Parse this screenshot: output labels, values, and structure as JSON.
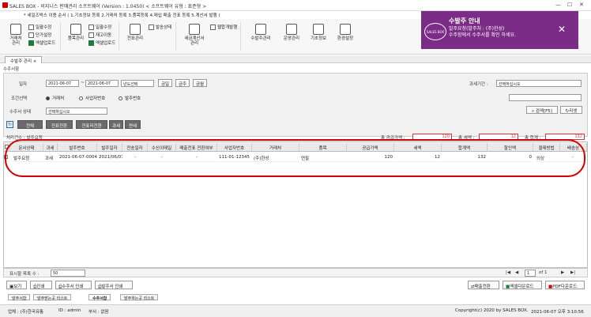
{
  "window": {
    "title": "SALES BOX - 비지니스 판매관리 소프트웨어 (Version : 1.0450) < 소프트웨어 유형 : 표준형 >",
    "marquee": "* 세일즈박스 이용 순서 ( 1.기초정보 등록 2.거래처 등록 3.품목등록 4.매입 매출 전표 등록 5.계산서 발행 )"
  },
  "ribbon": {
    "big": [
      {
        "label": "거래처\n관리"
      },
      {
        "label": "품목관리"
      },
      {
        "label": "전표관리"
      },
      {
        "label": "세금계산서\n관리"
      },
      {
        "label": "수발주관리"
      },
      {
        "label": "운영관리"
      },
      {
        "label": "기초정보"
      },
      {
        "label": "환경설정"
      }
    ],
    "small": {
      "cust_upload": "일괄수정",
      "cust_price": "단가설정",
      "cust_excel": "엑셀업로드",
      "item_upload": "일괄수정",
      "item_stock": "재고이동",
      "item_excel": "엑셀업로드",
      "slip_send": "발송상태",
      "tax_dev": "웹합개발행"
    }
  },
  "notice": {
    "logo": "SALES BOX",
    "title": "수발주 안내",
    "line1": "발주요청(발주처 : (주)한성)",
    "line2": "수주함에서 수주서를 확인 하세요.",
    "close": "✕"
  },
  "tabs": {
    "active": "수발주 관리",
    "close": "×"
  },
  "section_title": "수주서함",
  "filters": {
    "date_label": "일자",
    "date_from": "2021-06-07",
    "tilde": "~",
    "date_to": "2021-06-07",
    "year_select": "년도선택",
    "today": "금일",
    "this_week": "금주",
    "this_month": "금월",
    "tax_period_label": "과세기간 :",
    "tax_period_value": "선택하십시오",
    "cond_label": "조건선택",
    "radio_customer": "거래처",
    "radio_bizno": "사업자번호",
    "radio_orderno": "발주번호",
    "status_label": "수주서 상태",
    "status_value": "선택하십시오",
    "search_btn": "검색[F5]",
    "reset_btn": "리셋"
  },
  "view_buttons": [
    "전체",
    "전표전환",
    "전표미전환",
    "과세",
    "면세"
  ],
  "summary": {
    "count_label": "처리건수 : 발주요청",
    "supply_label": "총 공급가액 :",
    "supply_value": "120",
    "tax_label": "총 세액 :",
    "tax_value": "12",
    "total_label": "총 합계 :",
    "total_value": "132"
  },
  "table": {
    "headers": [
      "문서상태",
      "과세",
      "발주번호",
      "발주일자",
      "전송일자",
      "수신이메일",
      "매출전표 전환여부",
      "사업자번호",
      "거래처",
      "품목",
      "공급가액",
      "세액",
      "합계액",
      "할인액",
      "결제방법",
      "배송상"
    ],
    "rows": [
      [
        "발주요청",
        "과세",
        "2021-06-07-0004",
        "2021/06/07",
        "-",
        "-",
        "-",
        "111-01-12345",
        "(주)한성",
        "연필",
        "120",
        "12",
        "132",
        "0",
        "외상",
        "-"
      ]
    ]
  },
  "footer": {
    "rows_label": "표시할 목록 수 :",
    "rows_value": "50",
    "page_text": "1",
    "page_of": "of 1"
  },
  "bottom_buttons": {
    "view": "보기",
    "print": "인쇄",
    "order_print": "수주서 인쇄",
    "po_print": "발주서 인쇄",
    "to_sales": "매출전환",
    "excel_download": "엑셀다운로드",
    "pdf_download": "PDF다운로드"
  },
  "bottom_tabs": [
    "발주서함",
    "발주받는곳 리스트",
    "수주서함",
    "발주하는곳 리스트"
  ],
  "status_bar": {
    "company": "업체 : (주)한국유통",
    "user": "ID : admin",
    "dept": "부서 : 없음",
    "copyright": "Copyright(c) 2020 by SALES BOX.",
    "datetime": "2021-06-07 오후 3:10:56"
  },
  "colors": {
    "accent": "#7b2c86",
    "highlight": "#d10000"
  }
}
